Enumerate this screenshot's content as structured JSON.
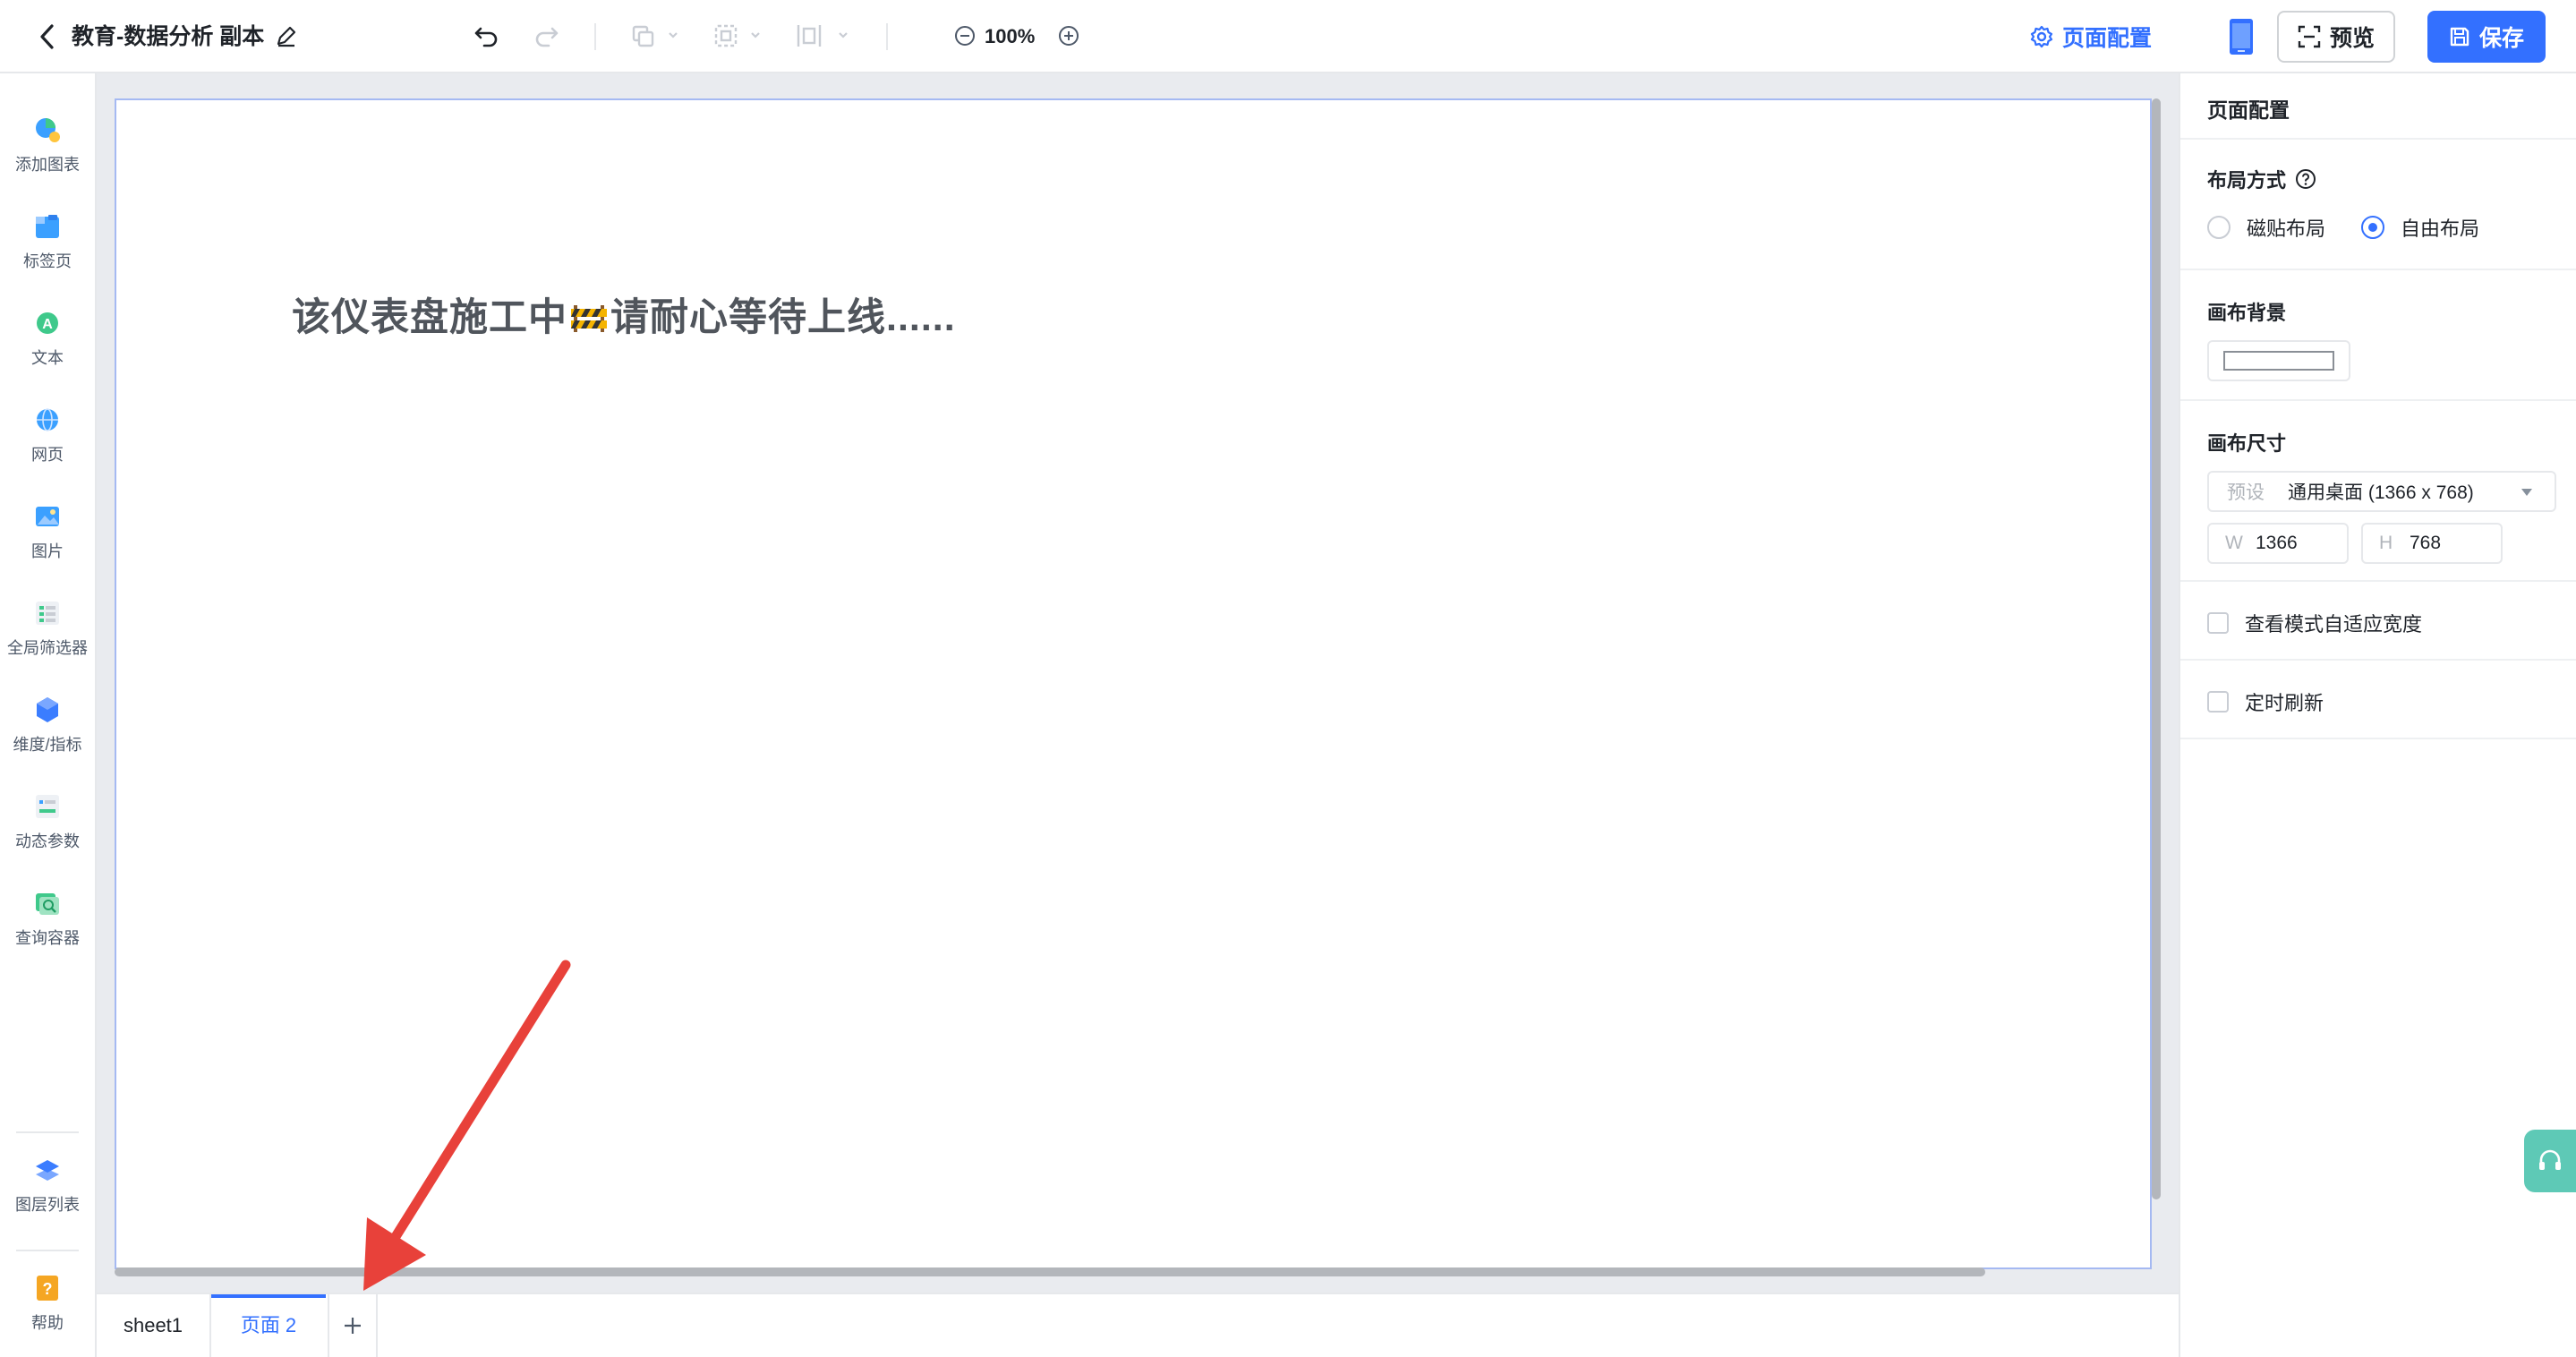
{
  "header": {
    "title": "教育-数据分析 副本",
    "zoom": "100%",
    "page_config_label": "页面配置",
    "preview_label": "预览",
    "save_label": "保存"
  },
  "sidebar": {
    "items": [
      {
        "label": "添加图表",
        "icon": "add-chart-icon"
      },
      {
        "label": "标签页",
        "icon": "tab-page-icon"
      },
      {
        "label": "文本",
        "icon": "text-icon"
      },
      {
        "label": "网页",
        "icon": "webpage-icon"
      },
      {
        "label": "图片",
        "icon": "image-icon"
      },
      {
        "label": "全局筛选器",
        "icon": "global-filter-icon"
      },
      {
        "label": "维度/指标",
        "icon": "dimension-metric-icon"
      },
      {
        "label": "动态参数",
        "icon": "dynamic-param-icon"
      },
      {
        "label": "查询容器",
        "icon": "query-container-icon"
      }
    ],
    "bottom": [
      {
        "label": "图层列表",
        "icon": "layer-list-icon"
      },
      {
        "label": "帮助",
        "icon": "help-icon"
      }
    ]
  },
  "canvas": {
    "text_before": "该仪表盘施工中",
    "text_after": "请耐心等待上线......"
  },
  "tabs": [
    {
      "label": "sheet1",
      "active": false
    },
    {
      "label": "页面 2",
      "active": true
    }
  ],
  "panel": {
    "title": "页面配置",
    "layout_label": "布局方式",
    "layout_options": [
      "磁贴布局",
      "自由布局"
    ],
    "layout_selected": "自由布局",
    "background_label": "画布背景",
    "background_color": "#ffffff",
    "size_label": "画布尺寸",
    "preset_prefix": "预设",
    "preset_value": "通用桌面 (1366 x 768)",
    "width_prefix": "W",
    "width_value": "1366",
    "height_prefix": "H",
    "height_value": "768",
    "fit_width_label": "查看模式自适应宽度",
    "auto_refresh_label": "定时刷新"
  },
  "colors": {
    "accent": "#3370ff",
    "support": "#5ec9b6",
    "annotation_arrow": "#e8413a"
  }
}
